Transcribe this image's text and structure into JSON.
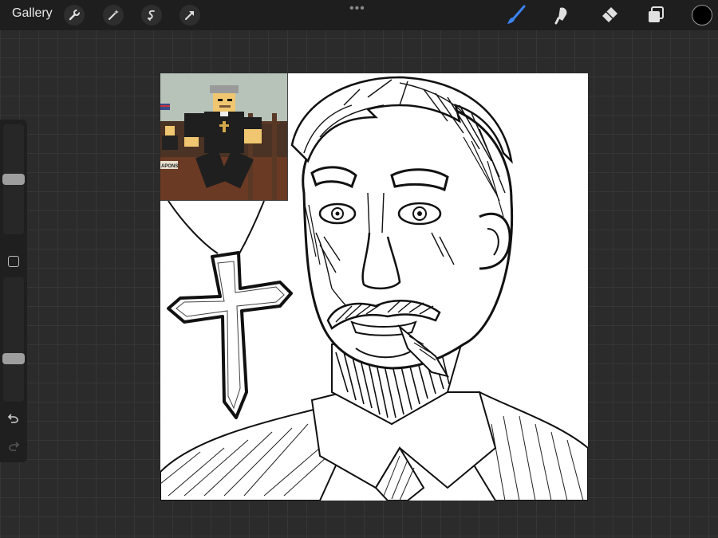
{
  "toolbar": {
    "gallery_label": "Gallery",
    "left_tools": [
      "wrench-icon",
      "magic-wand-icon",
      "selection-icon",
      "transform-arrow-icon"
    ],
    "right_tools": [
      "brush-icon",
      "smudge-icon",
      "eraser-icon",
      "layers-icon"
    ],
    "active_tool": "brush-icon",
    "active_color": "#000000",
    "accent": "#3b82f6"
  },
  "sidebar": {
    "brush_size": 0.5,
    "opacity": 0.33
  },
  "reference": {
    "sign_text": "APONS"
  }
}
